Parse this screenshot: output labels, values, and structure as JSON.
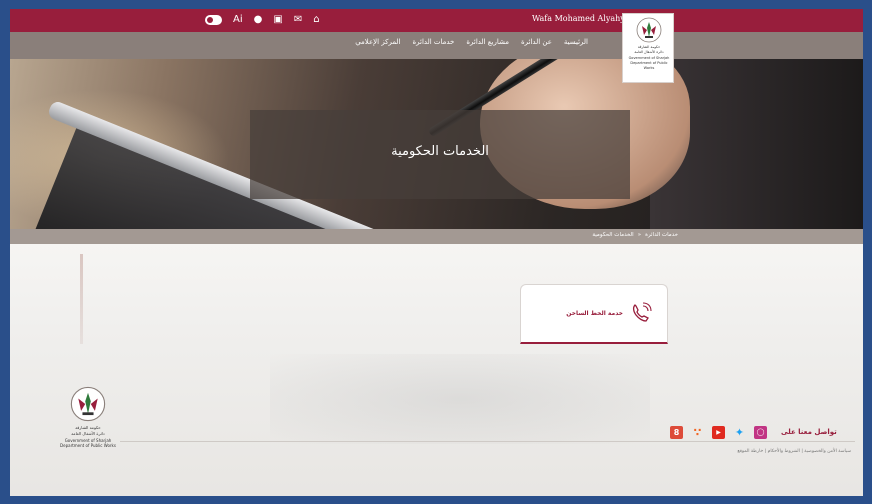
{
  "topbar": {
    "user_name": "Wafa Mohamed Alyahyaee",
    "icons": [
      "toggle-icon",
      "ai-icon",
      "chat-icon",
      "document-icon",
      "mail-icon",
      "home-icon"
    ],
    "ai_label": "Ai",
    "accent": "#981e3c"
  },
  "nav": {
    "items": [
      "الرئيسية",
      "عن الدائرة",
      "مشاريع الدائرة",
      "خدمات الدائرة",
      "المركز الإعلامي"
    ]
  },
  "logo": {
    "ar_name": "حكومة الشارقة",
    "ar_dept": "دائرة الأشغال العامة",
    "en_name": "Government of Sharjah",
    "en_dept": "Department of Public Works"
  },
  "hero": {
    "title": "الخدمات الحكومية"
  },
  "breadcrumb": {
    "items": [
      "خدمات الدائرة",
      "الخدمات الحكومية"
    ],
    "separator": "»"
  },
  "card": {
    "label": "خدمة الخط الساخن",
    "icon": "phone-icon"
  },
  "footer": {
    "contact_label": "تواصل معنا على",
    "social": [
      "instagram-icon",
      "twitter-icon",
      "youtube-icon",
      "rss-icon",
      "google-plus-icon"
    ],
    "links": "سياسة الأمن والخصوصية | الشروط والأحكام | خارطة الموقع"
  }
}
